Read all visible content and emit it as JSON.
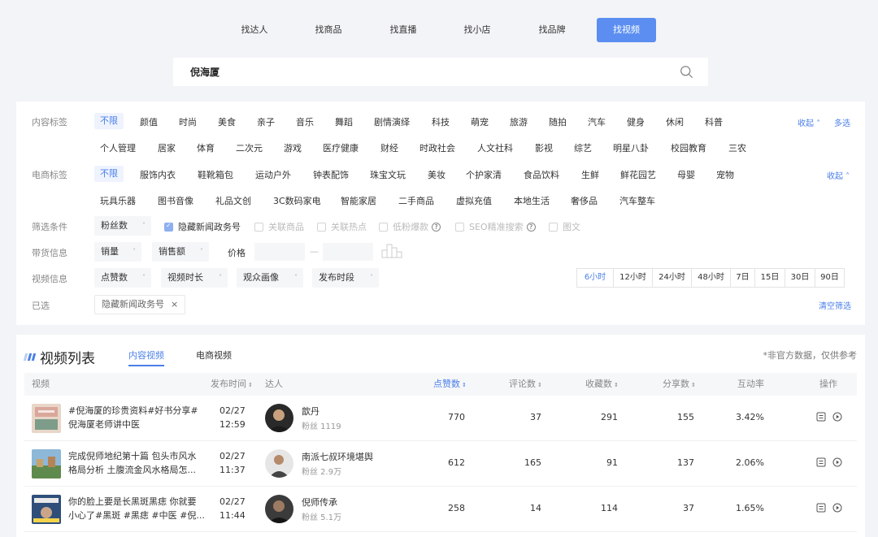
{
  "top_tabs": [
    {
      "label": "找达人",
      "active": false
    },
    {
      "label": "找商品",
      "active": false
    },
    {
      "label": "找直播",
      "active": false
    },
    {
      "label": "找小店",
      "active": false
    },
    {
      "label": "找品牌",
      "active": false
    },
    {
      "label": "找视频",
      "active": true
    }
  ],
  "search": {
    "value": "倪海厦",
    "icon": "search-icon"
  },
  "filters": {
    "content_tags": {
      "label": "内容标签",
      "selected": "不限",
      "row1": [
        "颜值",
        "时尚",
        "美食",
        "亲子",
        "音乐",
        "舞蹈",
        "剧情演绎",
        "科技",
        "萌宠",
        "旅游",
        "随拍",
        "汽车",
        "健身",
        "休闲",
        "科普"
      ],
      "row2": [
        "个人管理",
        "居家",
        "体育",
        "二次元",
        "游戏",
        "医疗健康",
        "财经",
        "时政社会",
        "人文社科",
        "影视",
        "综艺",
        "明星八卦",
        "校园教育",
        "三农"
      ],
      "collapse": "收起",
      "multi": "多选"
    },
    "ecom_tags": {
      "label": "电商标签",
      "selected": "不限",
      "row1": [
        "服饰内衣",
        "鞋靴箱包",
        "运动户外",
        "钟表配饰",
        "珠宝文玩",
        "美妆",
        "个护家清",
        "食品饮料",
        "生鲜",
        "鲜花园艺",
        "母婴",
        "宠物"
      ],
      "row2": [
        "玩具乐器",
        "图书音像",
        "礼品文创",
        "3C数码家电",
        "智能家居",
        "二手商品",
        "虚拟充值",
        "本地生活",
        "奢侈品",
        "汽车整车"
      ],
      "collapse": "收起"
    },
    "conditions": {
      "label": "筛选条件",
      "fans_dropdown": "粉丝数",
      "hide_gov": "隐藏新闻政务号",
      "linked_product": "关联商品",
      "linked_hot": "关联热点",
      "low_fans": "低粉爆款",
      "seo": "SEO精准搜索",
      "image_text": "图文"
    },
    "goods": {
      "label": "带货信息",
      "sales": "销量",
      "revenue": "销售额",
      "price": "价格",
      "dash": "—"
    },
    "video": {
      "label": "视频信息",
      "likes": "点赞数",
      "duration": "视频时长",
      "audience": "观众画像",
      "publish_slot": "发布时段",
      "time_ranges": [
        "6小时",
        "12小时",
        "24小时",
        "48小时",
        "7日",
        "15日",
        "30日",
        "90日"
      ]
    },
    "selected": {
      "label": "已选",
      "tag": "隐藏新闻政务号",
      "close": "×",
      "clear": "清空筛选"
    }
  },
  "list": {
    "title": "视频列表",
    "tabs": [
      {
        "label": "内容视频",
        "active": true
      },
      {
        "label": "电商视频",
        "active": false
      }
    ],
    "note": "*非官方数据，仅供参考",
    "columns": {
      "video": "视频",
      "publish_time": "发布时间",
      "creator": "达人",
      "likes": "点赞数",
      "comments": "评论数",
      "favorites": "收藏数",
      "shares": "分享数",
      "engagement": "互动率",
      "actions": "操作"
    },
    "rows": [
      {
        "title": "#倪海厦的珍贵资料#好书分享#倪海厦老师讲中医",
        "date": "02/27",
        "time": "12:59",
        "creator": "歆丹",
        "fans": "粉丝 1119",
        "likes": "770",
        "comments": "37",
        "favorites": "291",
        "shares": "155",
        "engagement": "3.42%"
      },
      {
        "title": "完成倪师地纪第十篇 包头市风水格局分析 土腹流金风水格局怎...",
        "date": "02/27",
        "time": "11:37",
        "creator": "南派七叔环境堪舆",
        "fans": "粉丝 2.9万",
        "likes": "612",
        "comments": "165",
        "favorites": "91",
        "shares": "137",
        "engagement": "2.06%"
      },
      {
        "title": "你的脸上要是长黑斑黑痣 你就要小心了#黑斑 #黑痣 #中医 #倪...",
        "date": "02/27",
        "time": "11:44",
        "creator": "倪师传承",
        "fans": "粉丝 5.1万",
        "likes": "258",
        "comments": "14",
        "favorites": "114",
        "shares": "37",
        "engagement": "1.65%"
      }
    ]
  },
  "colors": {
    "accent": "#4a7fe8",
    "tab_active_bg": "#5b8ef0",
    "page_bg": "#f3f4f7"
  }
}
